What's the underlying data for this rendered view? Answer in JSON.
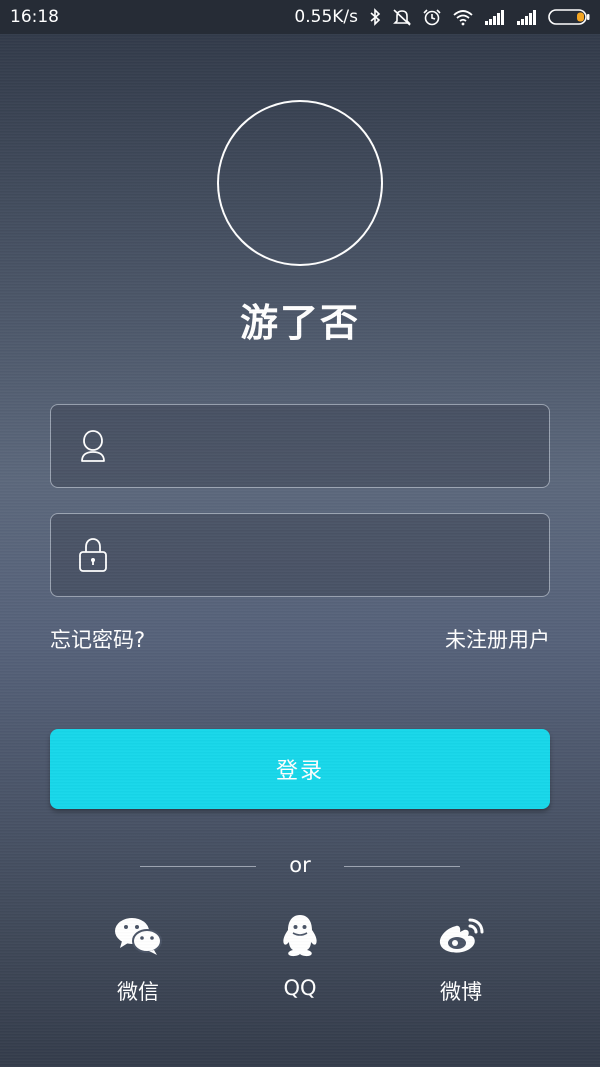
{
  "status_bar": {
    "time": "16:18",
    "network_speed": "0.55K/s",
    "icons": [
      "bluetooth-icon",
      "mute-icon",
      "alarm-icon",
      "wifi-icon",
      "signal-icon",
      "signal-icon",
      "battery-icon"
    ],
    "battery_accent": "#f5a623"
  },
  "app": {
    "name": "游了否"
  },
  "login_form": {
    "username_placeholder": "",
    "password_placeholder": "",
    "forgot_password": "忘记密码?",
    "register": "未注册用户",
    "login_button": "登录",
    "login_button_color": "#17d7ea"
  },
  "divider": {
    "text": "or"
  },
  "social_login": [
    {
      "label": "微信",
      "icon": "wechat-icon"
    },
    {
      "label": "QQ",
      "icon": "qq-icon"
    },
    {
      "label": "微博",
      "icon": "weibo-icon"
    }
  ]
}
